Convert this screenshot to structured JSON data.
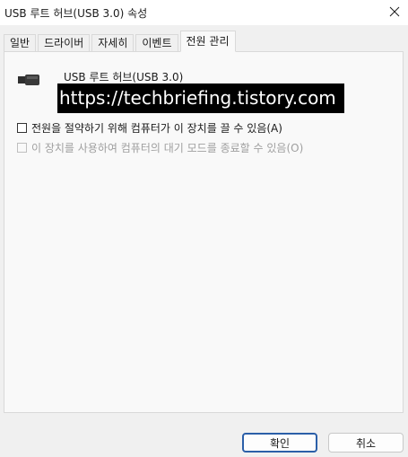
{
  "window": {
    "title": "USB 루트 허브(USB 3.0) 속성"
  },
  "tabs": [
    {
      "label": "일반"
    },
    {
      "label": "드라이버"
    },
    {
      "label": "자세히"
    },
    {
      "label": "이벤트"
    },
    {
      "label": "전원 관리",
      "active": true
    }
  ],
  "device": {
    "name": "USB 루트 허브(USB 3.0)",
    "icon": "usb-connector-icon"
  },
  "watermark": "https://techbriefing.tistory.com",
  "options": [
    {
      "label": "전원을 절약하기 위해 컴퓨터가 이 장치를 끌 수 있음(A)",
      "checked": false,
      "enabled": true
    },
    {
      "label": "이 장치를 사용하여 컴퓨터의 대기 모드를 종료할 수 있음(O)",
      "checked": false,
      "enabled": false
    }
  ],
  "buttons": {
    "ok": "확인",
    "cancel": "취소"
  },
  "colors": {
    "ok_border": "#2b5fa8",
    "panel": "#f9f9f9",
    "background": "#f0f0f0"
  }
}
